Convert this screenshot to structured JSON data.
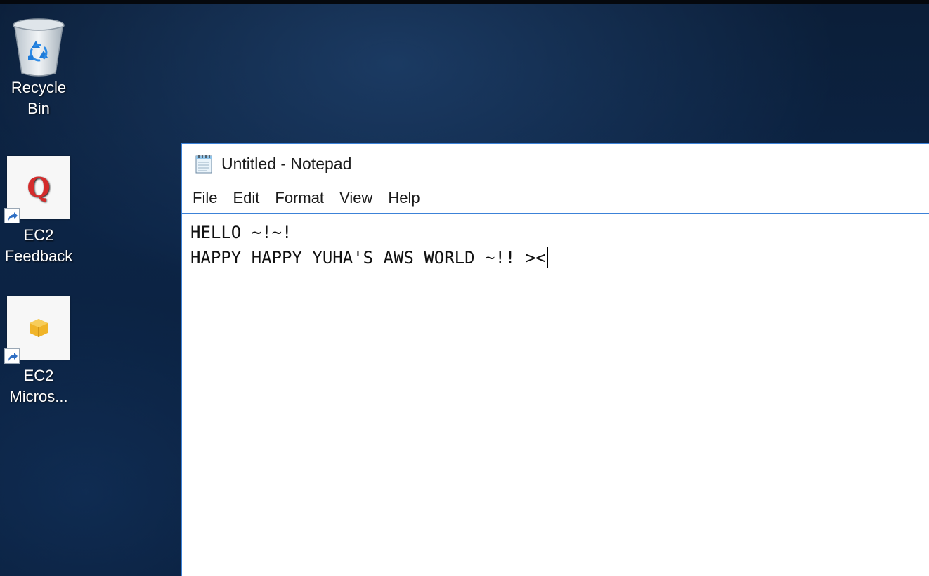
{
  "desktop": {
    "icons": [
      {
        "label": "Recycle Bin",
        "icon": "recycle-bin-icon"
      },
      {
        "label_lines": [
          "EC2",
          "Feedback"
        ],
        "icon": "ec2-feedback-icon",
        "glyph": "Q"
      },
      {
        "label_lines": [
          "EC2",
          "Micros..."
        ],
        "icon": "ec2-microsoft-icon"
      }
    ]
  },
  "notepad": {
    "title": "Untitled - Notepad",
    "menu": [
      "File",
      "Edit",
      "Format",
      "View",
      "Help"
    ],
    "content_lines": [
      "HELLO ~!~!",
      "HAPPY HAPPY YUHA'S AWS WORLD ~!! ><"
    ]
  },
  "colors": {
    "window_border": "#3c82d8",
    "feedback_q": "#d42b2b",
    "package": "#f0b429"
  }
}
